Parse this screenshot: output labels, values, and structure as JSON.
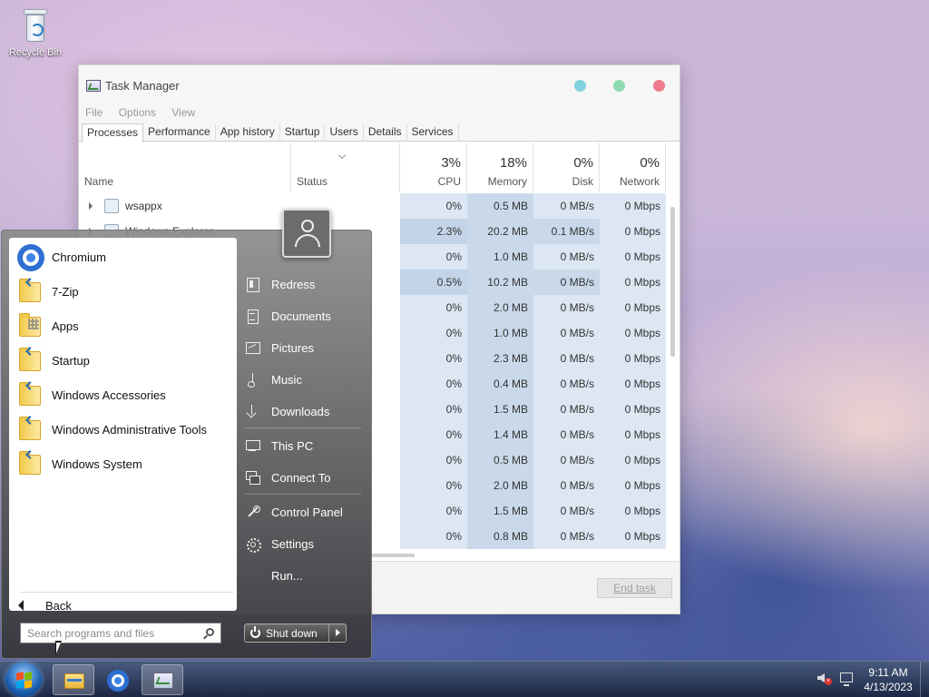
{
  "desktop": {
    "icons": [
      {
        "label": "Recycle Bin",
        "icon": "recycle-bin-icon"
      }
    ]
  },
  "task_manager": {
    "title": "Task Manager",
    "window_controls": {
      "minimize_color": "#7fd1de",
      "maximize_color": "#8fd9b0",
      "close_color": "#ef7c8e"
    },
    "menu": [
      "File",
      "Options",
      "View"
    ],
    "tabs": [
      "Processes",
      "Performance",
      "App history",
      "Startup",
      "Users",
      "Details",
      "Services"
    ],
    "active_tab": "Processes",
    "columns": {
      "name": "Name",
      "status": "Status",
      "cpu": {
        "percent": "3%",
        "label": "CPU"
      },
      "memory": {
        "percent": "18%",
        "label": "Memory"
      },
      "disk": {
        "percent": "0%",
        "label": "Disk"
      },
      "network": {
        "percent": "0%",
        "label": "Network"
      }
    },
    "processes": [
      {
        "name": "wsappx",
        "cpu": "0%",
        "memory": "0.5 MB",
        "disk": "0 MB/s",
        "network": "0 Mbps"
      },
      {
        "name": "Windows Explorer",
        "cpu": "2.3%",
        "memory": "20.2 MB",
        "disk": "0.1 MB/s",
        "network": "0 Mbps"
      },
      {
        "name": "",
        "cpu": "0%",
        "memory": "1.0 MB",
        "disk": "0 MB/s",
        "network": "0 Mbps"
      },
      {
        "name": "",
        "cpu": "0.5%",
        "memory": "10.2 MB",
        "disk": "0 MB/s",
        "network": "0 Mbps"
      },
      {
        "name": "",
        "cpu": "0%",
        "memory": "2.0 MB",
        "disk": "0 MB/s",
        "network": "0 Mbps"
      },
      {
        "name": "",
        "cpu": "0%",
        "memory": "1.0 MB",
        "disk": "0 MB/s",
        "network": "0 Mbps"
      },
      {
        "name": "",
        "cpu": "0%",
        "memory": "2.3 MB",
        "disk": "0 MB/s",
        "network": "0 Mbps"
      },
      {
        "name": "",
        "cpu": "0%",
        "memory": "0.4 MB",
        "disk": "0 MB/s",
        "network": "0 Mbps"
      },
      {
        "name": "",
        "cpu": "0%",
        "memory": "1.5 MB",
        "disk": "0 MB/s",
        "network": "0 Mbps"
      },
      {
        "name": "",
        "cpu": "0%",
        "memory": "1.4 MB",
        "disk": "0 MB/s",
        "network": "0 Mbps"
      },
      {
        "name": "",
        "cpu": "0%",
        "memory": "0.5 MB",
        "disk": "0 MB/s",
        "network": "0 Mbps"
      },
      {
        "name": "",
        "cpu": "0%",
        "memory": "2.0 MB",
        "disk": "0 MB/s",
        "network": "0 Mbps"
      },
      {
        "name": "",
        "cpu": "0%",
        "memory": "1.5 MB",
        "disk": "0 MB/s",
        "network": "0 Mbps"
      },
      {
        "name": "",
        "cpu": "0%",
        "memory": "0.8 MB",
        "disk": "0 MB/s",
        "network": "0 Mbps"
      }
    ],
    "end_task_label": "End task"
  },
  "start_menu": {
    "programs": [
      {
        "label": "Chromium",
        "icon": "chromium-icon"
      },
      {
        "label": "7-Zip",
        "icon": "folder-icon"
      },
      {
        "label": "Apps",
        "icon": "apps-folder-icon"
      },
      {
        "label": "Startup",
        "icon": "folder-icon"
      },
      {
        "label": "Windows Accessories",
        "icon": "folder-icon"
      },
      {
        "label": "Windows Administrative Tools",
        "icon": "folder-icon"
      },
      {
        "label": "Windows System",
        "icon": "folder-icon"
      }
    ],
    "back_label": "Back",
    "search_placeholder": "Search programs and files",
    "right_items": [
      {
        "label": "Redress",
        "icon": "user-folder-icon"
      },
      {
        "label": "Documents",
        "icon": "documents-icon"
      },
      {
        "label": "Pictures",
        "icon": "pictures-icon"
      },
      {
        "label": "Music",
        "icon": "music-icon"
      },
      {
        "label": "Downloads",
        "icon": "downloads-icon"
      },
      {
        "label": "This PC",
        "icon": "computer-icon"
      },
      {
        "label": "Connect To",
        "icon": "connect-icon"
      },
      {
        "label": "Control Panel",
        "icon": "control-panel-icon"
      },
      {
        "label": "Settings",
        "icon": "gear-icon"
      },
      {
        "label": "Run...",
        "icon": "run-icon"
      }
    ],
    "shutdown_label": "Shut down"
  },
  "taskbar": {
    "pinned": [
      {
        "name": "file-explorer",
        "icon": "folder-icon",
        "active": true
      },
      {
        "name": "chromium",
        "icon": "chromium-icon",
        "active": false
      },
      {
        "name": "task-manager",
        "icon": "task-manager-icon",
        "active": true
      }
    ],
    "clock_time": "9:11 AM",
    "clock_date": "4/13/2023"
  }
}
